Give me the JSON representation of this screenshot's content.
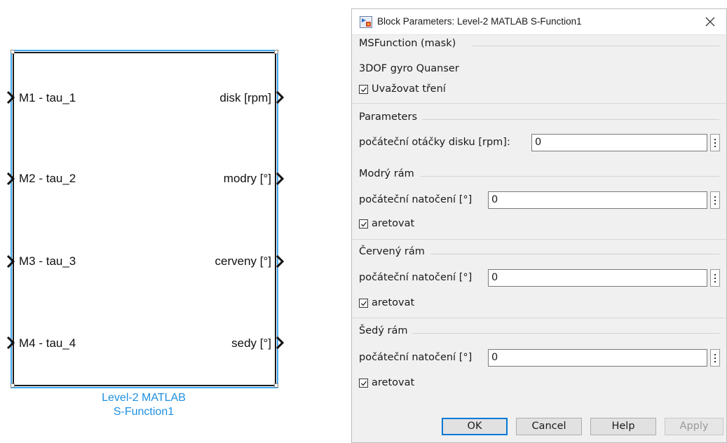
{
  "block": {
    "inputs": [
      "M1 - tau_1",
      "M2 - tau_2",
      "M3 - tau_3",
      "M4 - tau_4"
    ],
    "outputs": [
      "disk [rpm]",
      "modry [°]",
      "cerveny [°]",
      "sedy [°]"
    ],
    "name_line1": "Level-2 MATLAB",
    "name_line2": "S-Function1",
    "accent_color": "#1e90e0"
  },
  "dialog": {
    "title": "Block Parameters: Level-2 MATLAB S-Function1",
    "title_icon": "simulink-block-icon",
    "close_icon": "close-icon",
    "mask_group": {
      "title": "MSFunction (mask)",
      "description": "3DOF gyro Quanser",
      "friction_checkbox_label": "Uvažovat tření",
      "friction_checked": true
    },
    "parameters_group": {
      "title": "Parameters",
      "disk_label": "počáteční otáčky disku [rpm]:",
      "disk_value": "0"
    },
    "blue_frame": {
      "title": "Modrý rám",
      "angle_label": "počáteční natočení [°]",
      "angle_value": "0",
      "lock_label": "aretovat",
      "lock_checked": true
    },
    "red_frame": {
      "title": "Červený rám",
      "angle_label": "počáteční natočení [°]",
      "angle_value": "0",
      "lock_label": "aretovat",
      "lock_checked": true
    },
    "gray_frame": {
      "title": "Šedý rám",
      "angle_label": "počáteční natočení [°]",
      "angle_value": "0",
      "lock_label": "aretovat",
      "lock_checked": true
    },
    "buttons": {
      "ok": "OK",
      "cancel": "Cancel",
      "help": "Help",
      "apply": "Apply"
    }
  }
}
